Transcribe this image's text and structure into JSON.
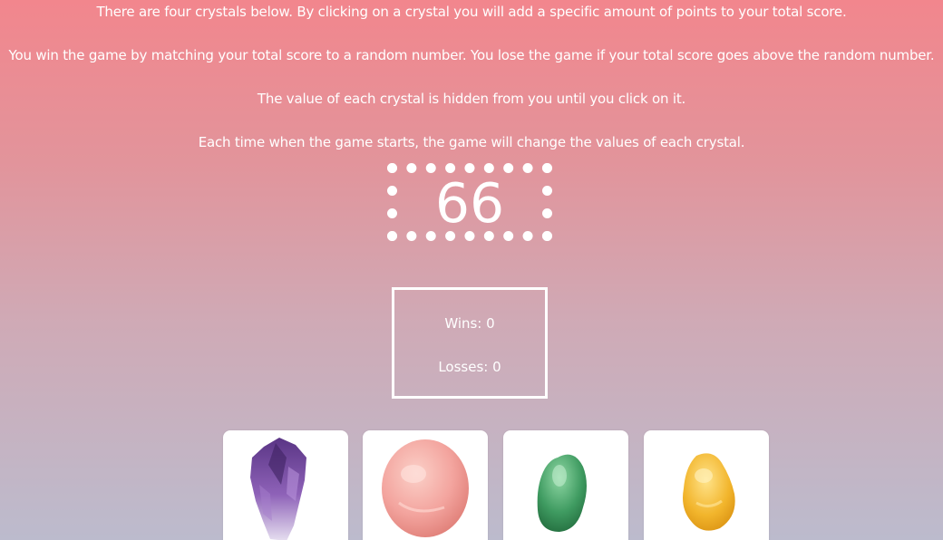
{
  "instructions": {
    "line1": "There are four crystals below. By clicking on a crystal you will add a specific amount of points to your total score.",
    "line2": "You win the game by matching your total score to a random number. You lose the game if your total score goes above the random number.",
    "line3": "The value of each crystal is hidden from you until you click on it.",
    "line4": "Each time when the game starts, the game will change the values of each crystal."
  },
  "target": {
    "number": "66"
  },
  "score": {
    "wins_text": "Wins: 0",
    "losses_text": "Losses: 0"
  },
  "crystals": [
    {
      "name": "amethyst",
      "color": "#7b4fa6"
    },
    {
      "name": "rose-quartz",
      "color": "#f3a49e"
    },
    {
      "name": "green-aventurine",
      "color": "#3f9b61"
    },
    {
      "name": "citrine",
      "color": "#f2b52c"
    }
  ],
  "colors": {
    "background_top": "#f2868d",
    "background_bottom": "#bcbbcd",
    "text": "#ffffff"
  }
}
